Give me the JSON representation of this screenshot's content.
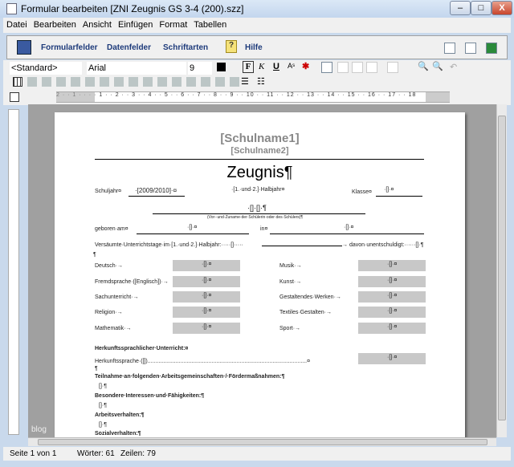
{
  "window": {
    "title": "Formular bearbeiten  [ZNI Zeugnis GS 3-4 (200).szz]",
    "minimize": "–",
    "maximize": "□",
    "close": "X"
  },
  "menu": [
    "Datei",
    "Bearbeiten",
    "Ansicht",
    "Einfügen",
    "Format",
    "Tabellen"
  ],
  "toolbar": {
    "formularfelder": "Formularfelder",
    "datenfelder": "Datenfelder",
    "schriftarten": "Schriftarten",
    "hilfe": "Hilfe"
  },
  "format": {
    "style": "<Standard>",
    "font": "Arial",
    "size": "9",
    "bold": "F",
    "italic": "K",
    "underline": "U",
    "superscript": "Aˢ"
  },
  "ruler": "2 · · 1 · · ·  · 1 · · 2 · · 3 · · 4 · · 5 · · 6 · · 7 · · 8 · · 9 · · 10 · · 11 · · 12 · · 13 · · 14 · · 15 · · 16 · · 17 · · 18",
  "doc": {
    "schulname1": "[Schulname1]",
    "schulname2": "[Schulname2]",
    "title": "Zeugnis¶",
    "schuljahr_label": "Schuljahr¤",
    "schuljahr_value": "·[2009/2010]·¤",
    "halbjahr": "·[1.·und·2.]·Halbjahr¤",
    "klasse_label": "Klasse¤",
    "field": "·[]·¤",
    "name_field": "·[]·[]·¶",
    "name_caption": "(Vor-·und·Zuname·der·Schülerin·oder·des·Schülers)¶",
    "geboren": "geboren·am¤",
    "in": "in¤",
    "versaeumt": "Versäumte·Unterrichtstage·im·[1.·und·2.]·Halbjahr:·····[]·····",
    "unentschuldigt": "→ davon·unentschuldigt:······[]·¶",
    "subjects_left": [
      "Deutsch·→",
      "Fremdsprache·([Englisch])·→",
      "Sachunterricht·→",
      "Religion·→",
      "Mathematik·→"
    ],
    "subjects_right": [
      "Musik·→",
      "Kunst·→",
      "Gestaltendes·Werken·→",
      "Textiles·Gestalten·→",
      "Sport·→"
    ],
    "herkunft_heading": "Herkunftssprachlicher·Unterricht:¤",
    "herkunft": "Herkunftssprache·([])......................................................................................................¤",
    "teilnahme": "Teilnahme·an·folgenden·Arbeitsgemeinschaften·/·Fördermaßnahmen:¶",
    "besondere": "Besondere·Interessen·und·Fähigkeiten:¶",
    "arbeit": "Arbeitsverhalten:¶",
    "sozial": "Sozialverhalten:¶",
    "placeholder": "[]·¶",
    "pilcrow": "¶"
  },
  "watermark": "blog",
  "status": {
    "page": "Seite 1 von 1",
    "words": "Wörter: 61",
    "lines": "Zeilen: 79"
  }
}
